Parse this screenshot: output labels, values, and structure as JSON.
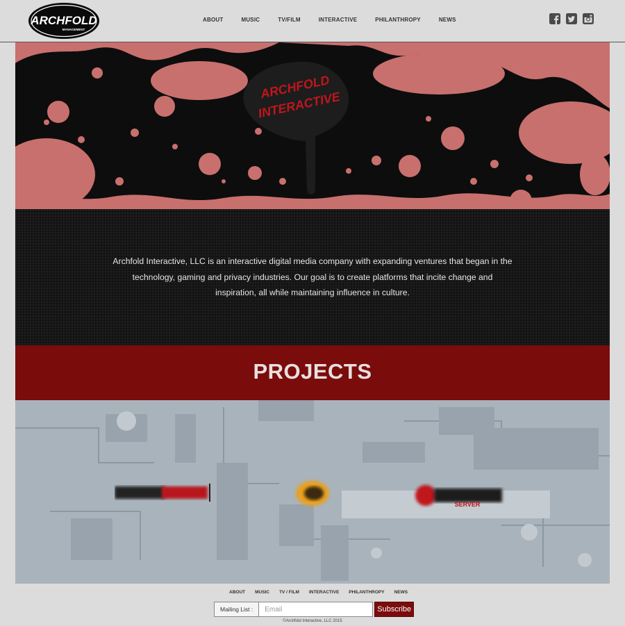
{
  "brand": {
    "logo_text": "ARCHFOLD",
    "logo_subtext": "MANAGEMENT"
  },
  "nav": {
    "items": [
      {
        "label": "ABOUT"
      },
      {
        "label": "MUSIC"
      },
      {
        "label": "TV/FILM"
      },
      {
        "label": "INTERACTIVE"
      },
      {
        "label": "PHILANTHROPY"
      },
      {
        "label": "NEWS"
      }
    ]
  },
  "social": [
    {
      "icon": "facebook-icon"
    },
    {
      "icon": "twitter-icon"
    },
    {
      "icon": "instagram-icon"
    }
  ],
  "hero": {
    "splat_text_line1": "ARCHFOLD",
    "splat_text_line2": "INTERACTIVE"
  },
  "about": {
    "text": "Archfold Interactive, LLC is an interactive digital media company with expanding ventures that began in the technology, gaming and privacy industries. Our goal is to create platforms that incite change and inspiration, all while maintaining influence in culture."
  },
  "projects": {
    "title": "PROJECTS",
    "logos": [
      {
        "icon": "project-logo-1-icon"
      },
      {
        "icon": "project-logo-2-icon"
      },
      {
        "icon": "project-logo-3-icon",
        "sub": "SERVER"
      }
    ]
  },
  "footer": {
    "nav": [
      {
        "label": "ABOUT"
      },
      {
        "label": "MUSIC"
      },
      {
        "label": "TV / FILM"
      },
      {
        "label": "INTERACTIVE"
      },
      {
        "label": "PHILANTHROPY"
      },
      {
        "label": "NEWS"
      }
    ],
    "mailing_label": "Mailing List :",
    "email_placeholder": "Email",
    "subscribe_label": "Subscribe",
    "copyright": "©Archfold Interactive, LLC 2015"
  },
  "colors": {
    "accent": "#7b0c0c",
    "splatter_pink": "#c8706e"
  }
}
